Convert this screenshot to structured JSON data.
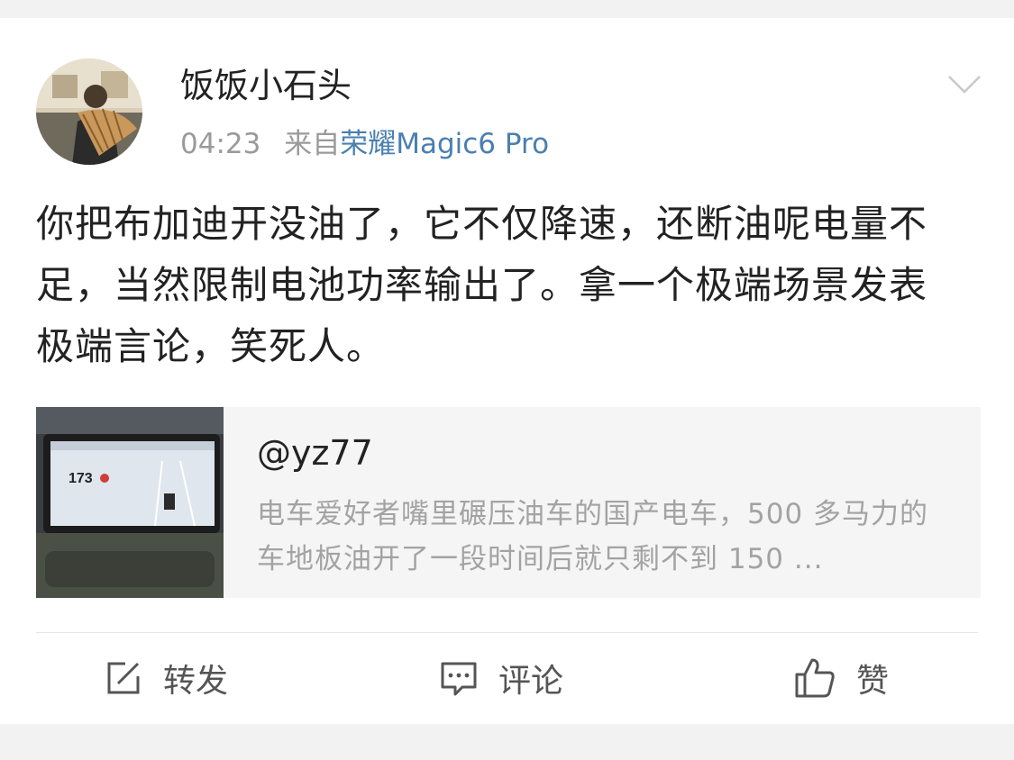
{
  "post": {
    "username": "饭饭小石头",
    "time": "04:23",
    "source_prefix": "来自",
    "source_device": "荣耀Magic6 Pro",
    "content": "你把布加迪开没油了，它不仅降速，还断油呢电量不足，当然限制电池功率输出了。拿一个极端场景发表极端言论，笑死人。"
  },
  "repost": {
    "username": "@yz77",
    "snippet": "电车爱好者嘴里碾压油车的国产电车，500 多马力的车地板油开了一段时间后就只剩不到 150 ...",
    "thumbnail_speed": "173"
  },
  "actions": {
    "repost_label": "转发",
    "comment_label": "评论",
    "like_label": "赞"
  },
  "colors": {
    "link": "#4a7fb0",
    "muted": "#9a9a9a",
    "repost_bg": "#f5f5f5"
  }
}
